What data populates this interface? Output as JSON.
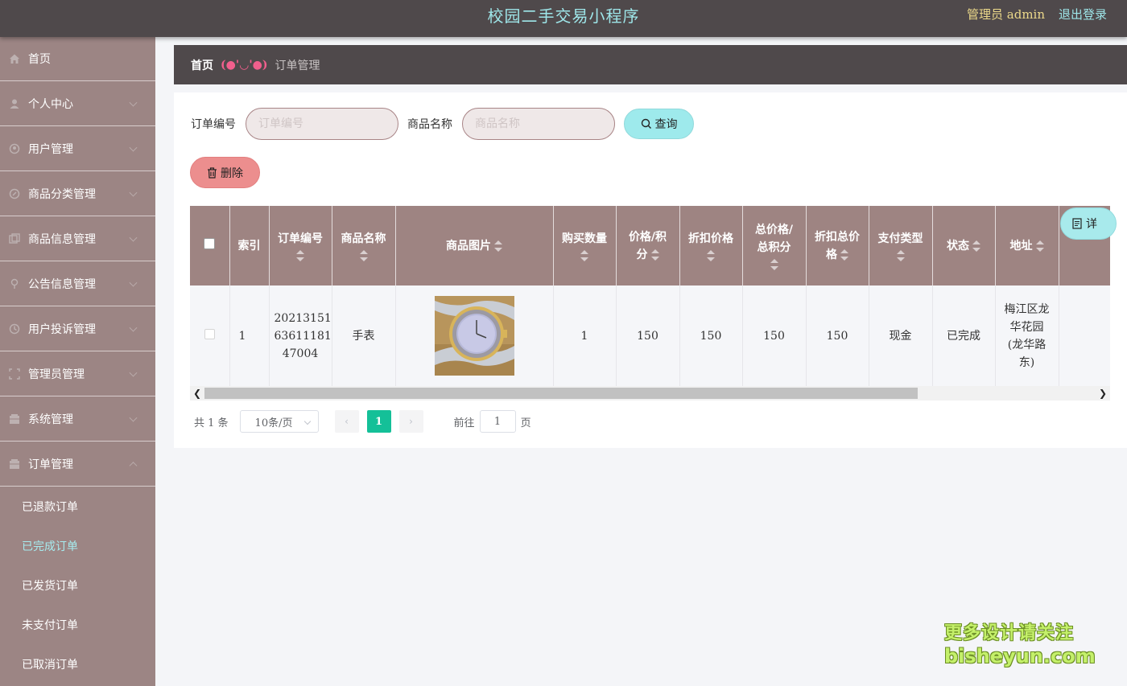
{
  "header": {
    "title": "校园二手交易小程序",
    "admin_label": "管理员 admin",
    "logout_label": "退出登录"
  },
  "sidebar": {
    "items": [
      {
        "label": "首页",
        "icon": "home-icon"
      },
      {
        "label": "个人中心",
        "icon": "user-icon"
      },
      {
        "label": "用户管理",
        "icon": "users-icon"
      },
      {
        "label": "商品分类管理",
        "icon": "category-icon"
      },
      {
        "label": "商品信息管理",
        "icon": "goods-icon"
      },
      {
        "label": "公告信息管理",
        "icon": "notice-icon"
      },
      {
        "label": "用户投诉管理",
        "icon": "complaint-icon"
      },
      {
        "label": "管理员管理",
        "icon": "admin-icon"
      },
      {
        "label": "系统管理",
        "icon": "system-icon"
      },
      {
        "label": "订单管理",
        "icon": "order-icon"
      }
    ],
    "subitems": [
      {
        "label": "已退款订单"
      },
      {
        "label": "已完成订单"
      },
      {
        "label": "已发货订单"
      },
      {
        "label": "未支付订单"
      },
      {
        "label": "已取消订单"
      }
    ]
  },
  "breadcrumb": {
    "home": "首页",
    "separator": "(●'◡'●)",
    "current": "订单管理"
  },
  "search": {
    "order_no_label": "订单编号",
    "order_no_placeholder": "订单编号",
    "goods_name_label": "商品名称",
    "goods_name_placeholder": "商品名称",
    "query_label": "查询",
    "delete_label": "删除"
  },
  "table": {
    "columns": {
      "index": "索引",
      "order_no": "订单编号",
      "goods_name": "商品名称",
      "goods_image": "商品图片",
      "quantity": "购买数量",
      "price_l1": "价格/积",
      "price_l2": "分",
      "discount_price": "折扣价格",
      "total_l1": "总价格/",
      "total_l2": "总积分",
      "discount_total_l1": "折扣总价",
      "discount_total_l2": "格",
      "pay_type": "支付类型",
      "status": "状态",
      "address": "地址"
    },
    "rows": [
      {
        "index": "1",
        "order_no_l1": "20213151",
        "order_no_l2": "63611181",
        "order_no_l3": "47004",
        "goods_name": "手表",
        "quantity": "1",
        "price": "150",
        "discount_price": "150",
        "total": "150",
        "discount_total": "150",
        "pay_type": "现金",
        "status": "已完成",
        "addr_l1": "梅江区龙",
        "addr_l2": "华花园",
        "addr_l3": "(龙华路",
        "addr_l4": "东)",
        "detail_label": "详"
      }
    ]
  },
  "pagination": {
    "total": "共 1 条",
    "page_size": "10条/页",
    "current_page": "1",
    "goto_label": "前往",
    "goto_value": "1",
    "page_suffix": "页"
  },
  "watermark": {
    "line1": "更多设计请关注",
    "line2": "bisheyun.com"
  },
  "colors": {
    "header_bg": "#4f494b",
    "sidebar_bg": "#9c8584",
    "accent_cyan": "#9eeaec",
    "delete_red": "#ec8e8e",
    "page_active": "#14c098"
  }
}
